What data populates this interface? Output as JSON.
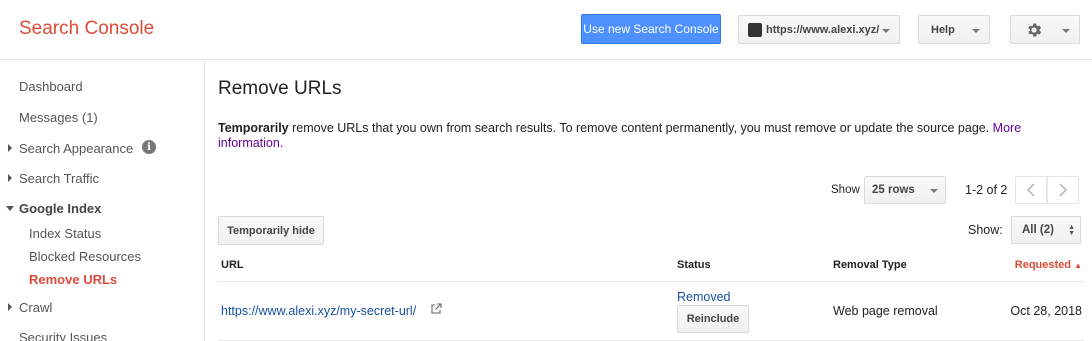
{
  "header": {
    "brand": "Search Console",
    "new_console_label": "Use new Search Console",
    "site_label": "https://www.alexi.xyz/",
    "help_label": "Help",
    "icons": {
      "site": "cube-icon",
      "settings": "gear-icon"
    }
  },
  "sidebar": {
    "items": [
      {
        "label": "Dashboard"
      },
      {
        "label": "Messages (1)"
      },
      {
        "label": "Search Appearance"
      },
      {
        "label": "Search Traffic"
      },
      {
        "label": "Google Index"
      },
      {
        "label": "Index Status"
      },
      {
        "label": "Blocked Resources"
      },
      {
        "label": "Remove URLs"
      },
      {
        "label": "Crawl"
      },
      {
        "label": "Security Issues"
      }
    ]
  },
  "main": {
    "title": "Remove URLs",
    "description_bold": "Temporarily",
    "description_text": " remove URLs that you own from search results. To remove content permanently, you must remove or update the source page. ",
    "more_info_link": "More information.",
    "pager": {
      "show_label": "Show",
      "rows_value": "25 rows",
      "range": "1-2 of 2"
    },
    "temp_hide_label": "Temporarily hide",
    "filter": {
      "label": "Show:",
      "value": "All (2)"
    },
    "table": {
      "headers": {
        "url": "URL",
        "status": "Status",
        "type": "Removal Type",
        "requested": "Requested"
      },
      "rows": [
        {
          "url": "https://www.alexi.xyz/my-secret-url/",
          "status": "Removed",
          "action": "Reinclude",
          "type": "Web page removal",
          "requested": "Oct 28, 2018"
        }
      ]
    }
  },
  "colors": {
    "brand": "#dd4b39",
    "primary_button": "#4d90fe",
    "link": "#1a4fa0",
    "visited_link": "#660099"
  }
}
